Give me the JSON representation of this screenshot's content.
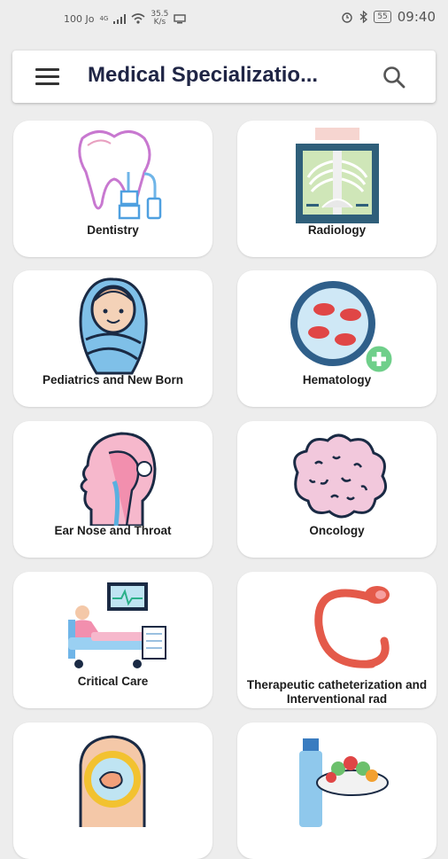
{
  "status_bar": {
    "network": "100 Jo",
    "signal_type": "4G",
    "speed_value": "35.5",
    "speed_unit": "K/s",
    "battery": "55",
    "time": "09:40"
  },
  "app_bar": {
    "title": "Medical Specializatio..."
  },
  "categories": [
    {
      "label": "Dentistry"
    },
    {
      "label": "Radiology"
    },
    {
      "label": "Pediatrics and New Born"
    },
    {
      "label": "Hematology"
    },
    {
      "label": "Ear Nose and Throat"
    },
    {
      "label": "Oncology"
    },
    {
      "label": "Critical Care"
    },
    {
      "label": "Therapeutic catheterization and Interventional rad"
    },
    {
      "label": ""
    },
    {
      "label": ""
    }
  ],
  "colors": {
    "background": "#ededed",
    "card": "#ffffff",
    "title": "#1f2545"
  }
}
